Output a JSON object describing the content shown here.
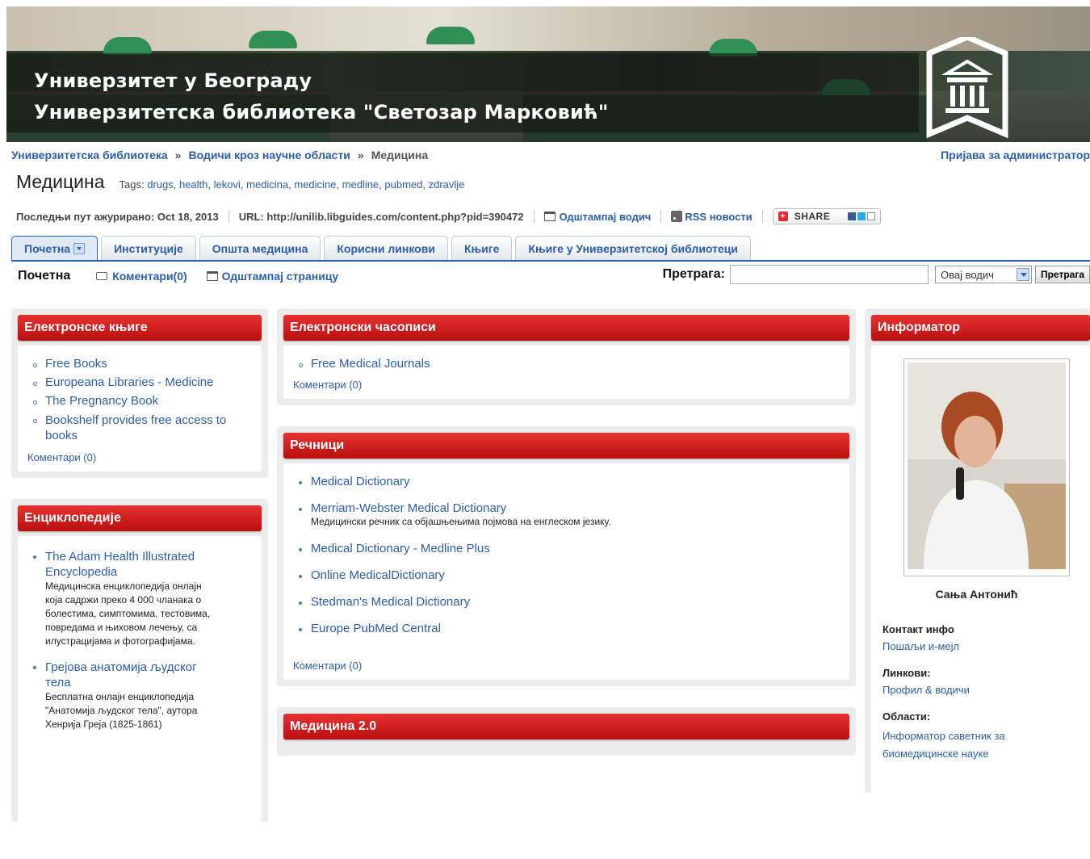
{
  "banner": {
    "line1": "Универзитет у Београду",
    "line2": "Универзитетска библиотека \"Светозар Марковић\""
  },
  "breadcrumb": {
    "items": [
      "Универзитетска библиотека",
      "Водичи кроз научне области",
      "Медицина"
    ],
    "separator": "»"
  },
  "admin_link": "Пријава за администратор",
  "page": {
    "title": "Медицина",
    "tags_label": "Tags:",
    "tags": [
      "drugs",
      "health",
      "lekovi",
      "medicina",
      "medicine",
      "medline",
      "pubmed",
      "zdravlje"
    ]
  },
  "meta": {
    "updated": "Последњи пут ажурирано: Oct 18, 2013",
    "url": "URL: http://unilib.libguides.com/content.php?pid=390472",
    "print_guide": "Одштампај водич",
    "rss": "RSS новости",
    "share": "SHARE"
  },
  "tabs": [
    "Почетна",
    "Институције",
    "Општа медицина",
    "Корисни линкови",
    "Књиге",
    "Књиге у Универзитетској библиотеци"
  ],
  "subbar": {
    "title": "Почетна",
    "comments": "Коментари(0)",
    "print_page": "Одштампај страницу",
    "search_label": "Претрага:",
    "search_value": "",
    "scope": "Овај водич",
    "search_button": "Претрага"
  },
  "left": {
    "ebooks": {
      "title": "Електронске књиге",
      "items": [
        "Free Books",
        "Europeana Libraries - Medicine",
        "The Pregnancy Book",
        "Bookshelf provides free access to books"
      ],
      "comments": "Коментари (0)"
    },
    "encyclopedias": {
      "title": "Енциклопедије",
      "items": [
        {
          "label": "The Adam Health Illustrated Encyclopedia",
          "desc": "Медицинска енциклопедија онлајн која садржи преко 4 000 чланака о болестима, симптомима, тестовима, повредама и њиховом лечењу, са илустрацијама и фотографијама."
        },
        {
          "label": "Грејова анатомија људског тела",
          "desc": "Бесплатна онлајн енциклопедија \"Анатомија људског тела\", аутора Хенрија Греја (1825-1861)"
        }
      ]
    }
  },
  "middle": {
    "journals": {
      "title": "Електронски часописи",
      "items": [
        "Free Medical Journals"
      ],
      "comments": "Коментари (0)"
    },
    "dictionaries": {
      "title": "Речници",
      "items": [
        {
          "label": "Medical Dictionary",
          "desc": ""
        },
        {
          "label": "Merriam-Webster Medical Dictionary",
          "desc": "Медицински речник са објашњењима појмова на енглеском језику."
        },
        {
          "label": "Medical Dictionary - Medline Plus",
          "desc": ""
        },
        {
          "label": "Online MedicalDictionary",
          "desc": ""
        },
        {
          "label": "Stedman's Medical Dictionary",
          "desc": ""
        },
        {
          "label": "Europe PubMed Central",
          "desc": ""
        }
      ],
      "comments": "Коментари (0)"
    },
    "med20": {
      "title": "Медицина 2.0"
    }
  },
  "right": {
    "informator": {
      "title": "Информатор",
      "name": "Сања Антонић",
      "contact_label": "Контакт инфо",
      "contact_link": "Пошаљи и-мејл",
      "links_label": "Линкови:",
      "links_link": "Профил & водичи",
      "areas_label": "Области:",
      "areas_link": "Информатор саветник за биомедицинске науке"
    }
  }
}
